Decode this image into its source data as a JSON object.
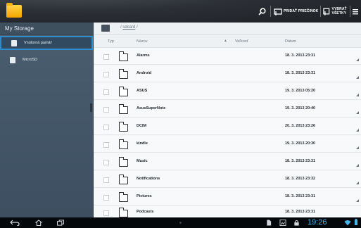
{
  "toolbar": {
    "app_icon": "folder-app-icon",
    "search_icon": "search-icon",
    "add_folder_label": "PRIDAŤ PRIEČINOK",
    "select_all_label": "VYBRAŤ VŠETKY",
    "menu_icon": "overflow-menu-icon"
  },
  "sidebar": {
    "title": "My Storage",
    "items": [
      {
        "label": "Vnútorná pamäť",
        "icon": "internal-storage-icon",
        "active": true
      },
      {
        "label": "MicroSD",
        "icon": "sd-card-icon",
        "active": false
      }
    ]
  },
  "path": {
    "prefix": "/ ",
    "link": "sdcard",
    "suffix": " /"
  },
  "columns": {
    "type": "Typ",
    "name": "Názov",
    "size": "Veľkosť",
    "date": "Dátum"
  },
  "files": [
    {
      "name": "Alarms",
      "date": "18. 3. 2013 23:31"
    },
    {
      "name": "Android",
      "date": "18. 3. 2013 23:31"
    },
    {
      "name": "ASUS",
      "date": "19. 3. 2013 05:20"
    },
    {
      "name": "AsusSuperNote",
      "date": "19. 3. 2013 20:40"
    },
    {
      "name": "DCIM",
      "date": "20. 3. 2013 23:26"
    },
    {
      "name": "kindle",
      "date": "19. 3. 2013 20:30"
    },
    {
      "name": "Music",
      "date": "18. 3. 2013 23:31"
    },
    {
      "name": "Notifications",
      "date": "18. 3. 2013 23:32"
    },
    {
      "name": "Pictures",
      "date": "18. 3. 2013 23:31"
    },
    {
      "name": "Podcasts",
      "date": "18. 3. 2013 23:31"
    }
  ],
  "status": {
    "clock": "19:26",
    "accent": "#45b7ee"
  }
}
